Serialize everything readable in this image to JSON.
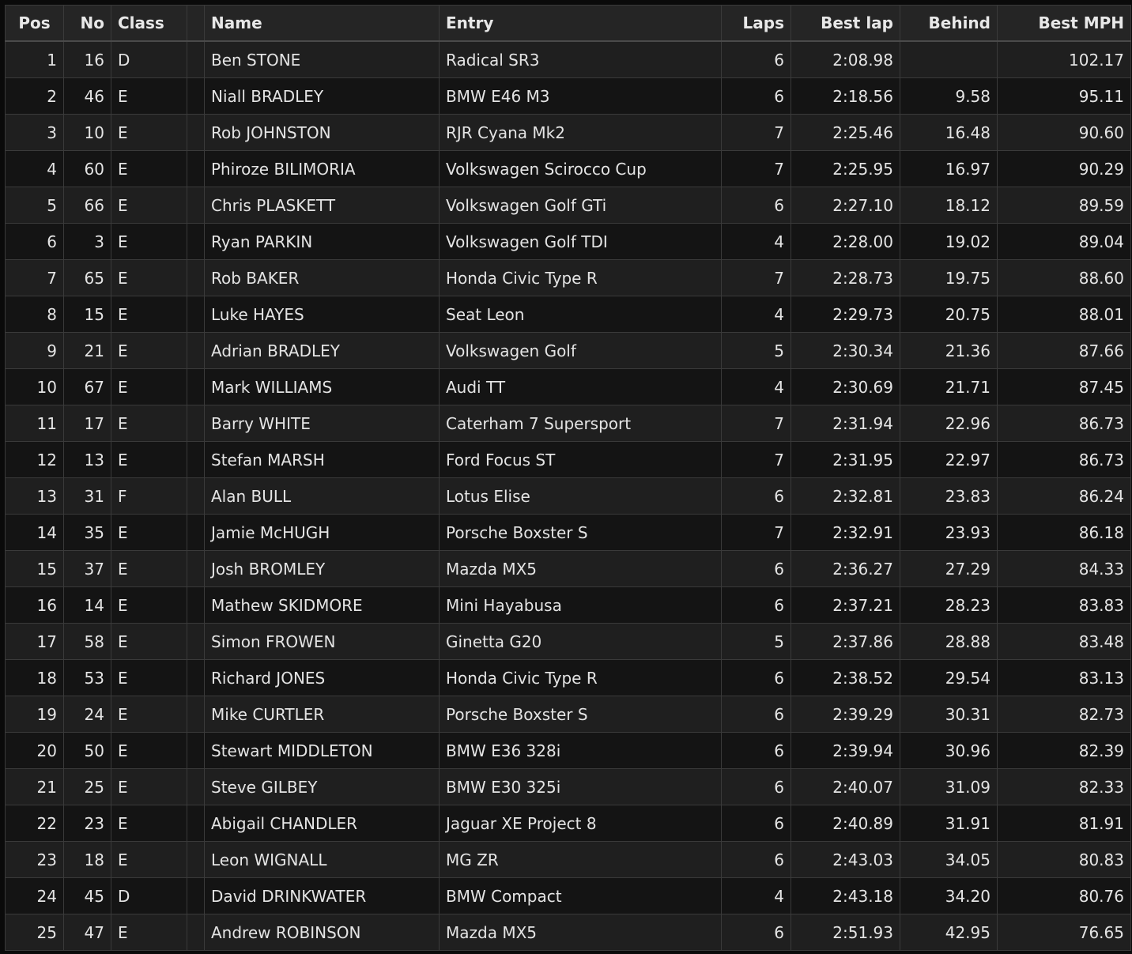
{
  "headers": {
    "pos": "Pos",
    "no": "No",
    "class": "Class",
    "name": "Name",
    "entry": "Entry",
    "laps": "Laps",
    "best_lap": "Best lap",
    "behind": "Behind",
    "best_mph": "Best MPH"
  },
  "rows": [
    {
      "pos": "1",
      "no": "16",
      "class": "D",
      "name": "Ben STONE",
      "entry": "Radical SR3",
      "laps": "6",
      "best_lap": "2:08.98",
      "behind": "",
      "best_mph": "102.17"
    },
    {
      "pos": "2",
      "no": "46",
      "class": "E",
      "name": "Niall BRADLEY",
      "entry": "BMW E46 M3",
      "laps": "6",
      "best_lap": "2:18.56",
      "behind": "9.58",
      "best_mph": "95.11"
    },
    {
      "pos": "3",
      "no": "10",
      "class": "E",
      "name": "Rob JOHNSTON",
      "entry": "RJR Cyana Mk2",
      "laps": "7",
      "best_lap": "2:25.46",
      "behind": "16.48",
      "best_mph": "90.60"
    },
    {
      "pos": "4",
      "no": "60",
      "class": "E",
      "name": "Phiroze BILIMORIA",
      "entry": "Volkswagen Scirocco Cup",
      "laps": "7",
      "best_lap": "2:25.95",
      "behind": "16.97",
      "best_mph": "90.29"
    },
    {
      "pos": "5",
      "no": "66",
      "class": "E",
      "name": "Chris PLASKETT",
      "entry": "Volkswagen Golf GTi",
      "laps": "6",
      "best_lap": "2:27.10",
      "behind": "18.12",
      "best_mph": "89.59"
    },
    {
      "pos": "6",
      "no": "3",
      "class": "E",
      "name": "Ryan PARKIN",
      "entry": "Volkswagen Golf TDI",
      "laps": "4",
      "best_lap": "2:28.00",
      "behind": "19.02",
      "best_mph": "89.04"
    },
    {
      "pos": "7",
      "no": "65",
      "class": "E",
      "name": "Rob BAKER",
      "entry": "Honda Civic Type R",
      "laps": "7",
      "best_lap": "2:28.73",
      "behind": "19.75",
      "best_mph": "88.60"
    },
    {
      "pos": "8",
      "no": "15",
      "class": "E",
      "name": "Luke HAYES",
      "entry": "Seat Leon",
      "laps": "4",
      "best_lap": "2:29.73",
      "behind": "20.75",
      "best_mph": "88.01"
    },
    {
      "pos": "9",
      "no": "21",
      "class": "E",
      "name": "Adrian BRADLEY",
      "entry": "Volkswagen Golf",
      "laps": "5",
      "best_lap": "2:30.34",
      "behind": "21.36",
      "best_mph": "87.66"
    },
    {
      "pos": "10",
      "no": "67",
      "class": "E",
      "name": "Mark WILLIAMS",
      "entry": "Audi TT",
      "laps": "4",
      "best_lap": "2:30.69",
      "behind": "21.71",
      "best_mph": "87.45"
    },
    {
      "pos": "11",
      "no": "17",
      "class": "E",
      "name": "Barry WHITE",
      "entry": "Caterham 7 Supersport",
      "laps": "7",
      "best_lap": "2:31.94",
      "behind": "22.96",
      "best_mph": "86.73"
    },
    {
      "pos": "12",
      "no": "13",
      "class": "E",
      "name": "Stefan MARSH",
      "entry": "Ford Focus ST",
      "laps": "7",
      "best_lap": "2:31.95",
      "behind": "22.97",
      "best_mph": "86.73"
    },
    {
      "pos": "13",
      "no": "31",
      "class": "F",
      "name": "Alan BULL",
      "entry": "Lotus Elise",
      "laps": "6",
      "best_lap": "2:32.81",
      "behind": "23.83",
      "best_mph": "86.24"
    },
    {
      "pos": "14",
      "no": "35",
      "class": "E",
      "name": "Jamie McHUGH",
      "entry": "Porsche Boxster S",
      "laps": "7",
      "best_lap": "2:32.91",
      "behind": "23.93",
      "best_mph": "86.18"
    },
    {
      "pos": "15",
      "no": "37",
      "class": "E",
      "name": "Josh BROMLEY",
      "entry": "Mazda MX5",
      "laps": "6",
      "best_lap": "2:36.27",
      "behind": "27.29",
      "best_mph": "84.33"
    },
    {
      "pos": "16",
      "no": "14",
      "class": "E",
      "name": "Mathew SKIDMORE",
      "entry": "Mini Hayabusa",
      "laps": "6",
      "best_lap": "2:37.21",
      "behind": "28.23",
      "best_mph": "83.83"
    },
    {
      "pos": "17",
      "no": "58",
      "class": "E",
      "name": "Simon FROWEN",
      "entry": "Ginetta G20",
      "laps": "5",
      "best_lap": "2:37.86",
      "behind": "28.88",
      "best_mph": "83.48"
    },
    {
      "pos": "18",
      "no": "53",
      "class": "E",
      "name": "Richard JONES",
      "entry": "Honda Civic Type R",
      "laps": "6",
      "best_lap": "2:38.52",
      "behind": "29.54",
      "best_mph": "83.13"
    },
    {
      "pos": "19",
      "no": "24",
      "class": "E",
      "name": "Mike CURTLER",
      "entry": "Porsche Boxster S",
      "laps": "6",
      "best_lap": "2:39.29",
      "behind": "30.31",
      "best_mph": "82.73"
    },
    {
      "pos": "20",
      "no": "50",
      "class": "E",
      "name": "Stewart MIDDLETON",
      "entry": "BMW E36 328i",
      "laps": "6",
      "best_lap": "2:39.94",
      "behind": "30.96",
      "best_mph": "82.39"
    },
    {
      "pos": "21",
      "no": "25",
      "class": "E",
      "name": "Steve GILBEY",
      "entry": "BMW E30 325i",
      "laps": "6",
      "best_lap": "2:40.07",
      "behind": "31.09",
      "best_mph": "82.33"
    },
    {
      "pos": "22",
      "no": "23",
      "class": "E",
      "name": "Abigail CHANDLER",
      "entry": "Jaguar XE Project 8",
      "laps": "6",
      "best_lap": "2:40.89",
      "behind": "31.91",
      "best_mph": "81.91"
    },
    {
      "pos": "23",
      "no": "18",
      "class": "E",
      "name": "Leon WIGNALL",
      "entry": "MG ZR",
      "laps": "6",
      "best_lap": "2:43.03",
      "behind": "34.05",
      "best_mph": "80.83"
    },
    {
      "pos": "24",
      "no": "45",
      "class": "D",
      "name": "David DRINKWATER",
      "entry": "BMW Compact",
      "laps": "4",
      "best_lap": "2:43.18",
      "behind": "34.20",
      "best_mph": "80.76"
    },
    {
      "pos": "25",
      "no": "47",
      "class": "E",
      "name": "Andrew ROBINSON",
      "entry": "Mazda MX5",
      "laps": "6",
      "best_lap": "2:51.93",
      "behind": "42.95",
      "best_mph": "76.65"
    }
  ]
}
